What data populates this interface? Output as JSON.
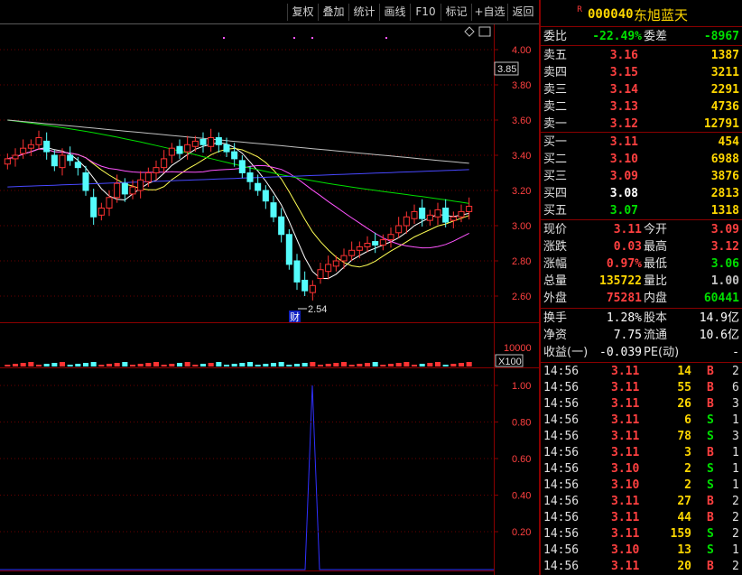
{
  "toolbar": {
    "buttons": [
      "复权",
      "叠加",
      "统计",
      "画线",
      "F10",
      "标记",
      "+自选",
      "返回"
    ]
  },
  "chart": {
    "price_ticks": [
      "4.00",
      "3.80",
      "3.60",
      "3.40",
      "3.20",
      "3.00",
      "2.80",
      "2.60"
    ],
    "current_price_tag": "3.85",
    "low_marker": "2.54",
    "finance_marker": "财",
    "volume_tick": "10000",
    "volume_unit": "X100",
    "indicator_ticks": [
      "1.00",
      "0.80",
      "0.60",
      "0.40",
      "0.20"
    ],
    "diamond_icon": "diamond-icon",
    "colors": {
      "up": "#ff3232",
      "down": "#54fcfc",
      "ma5": "#ffffff",
      "ma10": "#ffff54",
      "ma20": "#ff54ff",
      "ma60": "#00e000",
      "ma120": "#4848ff",
      "ma250": "#c0c0c0",
      "indicator": "#3030ff"
    }
  },
  "stock": {
    "r_mark": "R",
    "code": "000040",
    "name": "东旭蓝天"
  },
  "commission": {
    "label1": "委比",
    "value1": "-22.49%",
    "label2": "委差",
    "value2": "-8967"
  },
  "asks": [
    {
      "label": "卖五",
      "price": "3.16",
      "volume": "1387"
    },
    {
      "label": "卖四",
      "price": "3.15",
      "volume": "3211"
    },
    {
      "label": "卖三",
      "price": "3.14",
      "volume": "2291"
    },
    {
      "label": "卖二",
      "price": "3.13",
      "volume": "4736"
    },
    {
      "label": "卖一",
      "price": "3.12",
      "volume": "12791"
    }
  ],
  "bids": [
    {
      "label": "买一",
      "price": "3.11",
      "volume": "454",
      "color": "red"
    },
    {
      "label": "买二",
      "price": "3.10",
      "volume": "6988",
      "color": "red"
    },
    {
      "label": "买三",
      "price": "3.09",
      "volume": "3876",
      "color": "red"
    },
    {
      "label": "买四",
      "price": "3.08",
      "volume": "2813",
      "color": "white"
    },
    {
      "label": "买五",
      "price": "3.07",
      "volume": "1318",
      "color": "green"
    }
  ],
  "quote": [
    {
      "l1": "现价",
      "v1": "3.11",
      "c1": "red",
      "l2": "今开",
      "v2": "3.09",
      "c2": "red"
    },
    {
      "l1": "涨跌",
      "v1": "0.03",
      "c1": "red",
      "l2": "最高",
      "v2": "3.12",
      "c2": "red"
    },
    {
      "l1": "涨幅",
      "v1": "0.97%",
      "c1": "red",
      "l2": "最低",
      "v2": "3.06",
      "c2": "green"
    },
    {
      "l1": "总量",
      "v1": "135722",
      "c1": "yellow",
      "l2": "量比",
      "v2": "1.00",
      "c2": "gray"
    },
    {
      "l1": "外盘",
      "v1": "75281",
      "c1": "red",
      "l2": "内盘",
      "v2": "60441",
      "c2": "green"
    }
  ],
  "fundamentals": [
    {
      "l1": "换手",
      "v1": "1.28%",
      "l2": "股本",
      "v2": "14.9亿"
    },
    {
      "l1": "净资",
      "v1": "7.75",
      "l2": "流通",
      "v2": "10.6亿"
    },
    {
      "l1": "收益(一)",
      "v1": "-0.039",
      "l2": "PE(动)",
      "v2": "-"
    }
  ],
  "trades": [
    {
      "time": "14:56",
      "price": "3.11",
      "qty": "14",
      "side": "B",
      "n": "2"
    },
    {
      "time": "14:56",
      "price": "3.11",
      "qty": "55",
      "side": "B",
      "n": "6"
    },
    {
      "time": "14:56",
      "price": "3.11",
      "qty": "26",
      "side": "B",
      "n": "3"
    },
    {
      "time": "14:56",
      "price": "3.11",
      "qty": "6",
      "side": "S",
      "n": "1"
    },
    {
      "time": "14:56",
      "price": "3.11",
      "qty": "78",
      "side": "S",
      "n": "3"
    },
    {
      "time": "14:56",
      "price": "3.11",
      "qty": "3",
      "side": "B",
      "n": "1"
    },
    {
      "time": "14:56",
      "price": "3.10",
      "qty": "2",
      "side": "S",
      "n": "1"
    },
    {
      "time": "14:56",
      "price": "3.10",
      "qty": "2",
      "side": "S",
      "n": "1"
    },
    {
      "time": "14:56",
      "price": "3.11",
      "qty": "27",
      "side": "B",
      "n": "2"
    },
    {
      "time": "14:56",
      "price": "3.11",
      "qty": "44",
      "side": "B",
      "n": "2"
    },
    {
      "time": "14:56",
      "price": "3.11",
      "qty": "159",
      "side": "S",
      "n": "2"
    },
    {
      "time": "14:56",
      "price": "3.10",
      "qty": "13",
      "side": "S",
      "n": "1"
    },
    {
      "time": "14:56",
      "price": "3.11",
      "qty": "20",
      "side": "B",
      "n": "2"
    }
  ]
}
